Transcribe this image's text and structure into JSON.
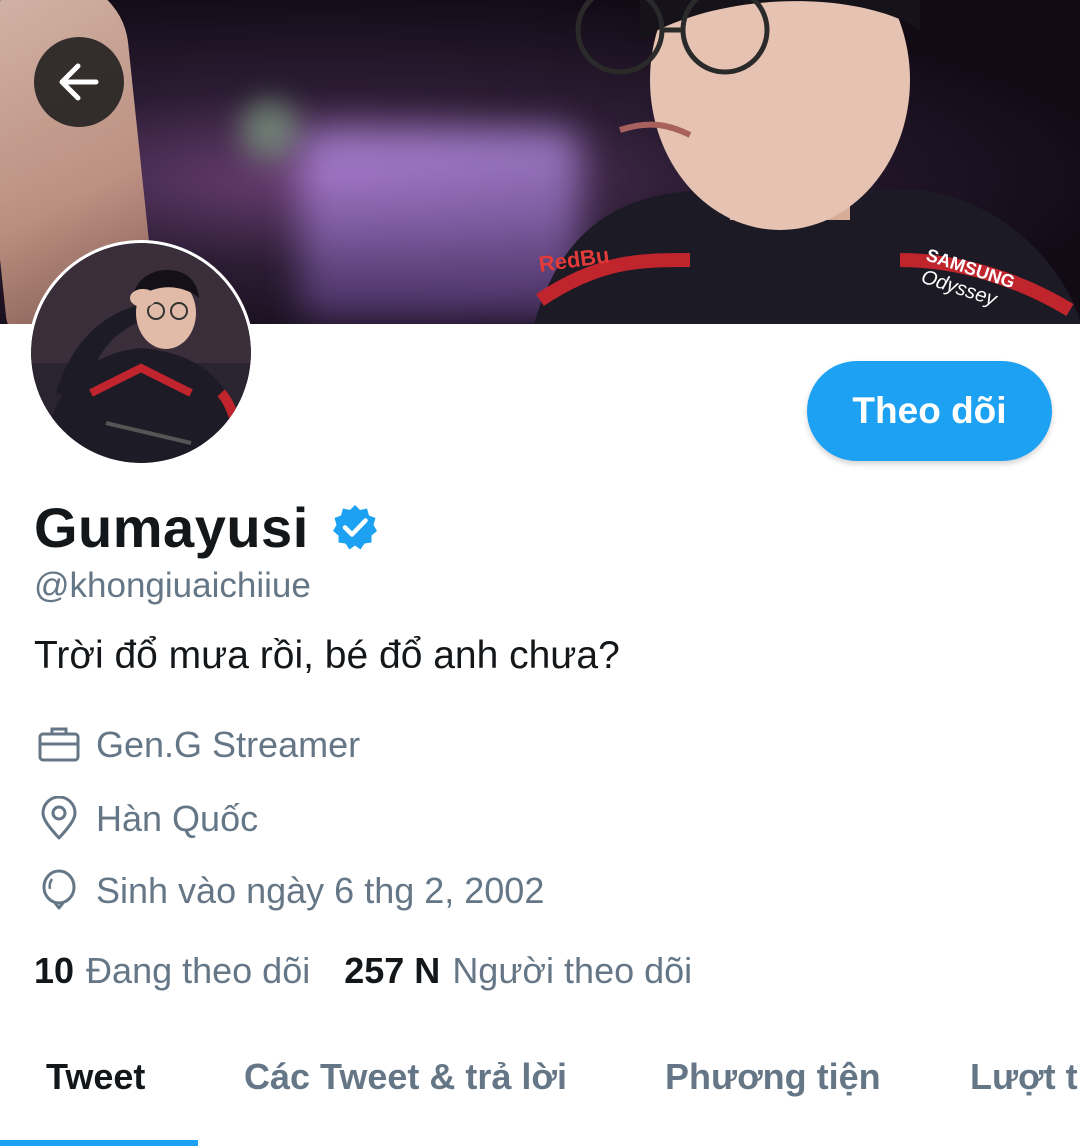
{
  "header": {
    "back_icon": "arrow-left-icon"
  },
  "profile": {
    "display_name": "Gumayusi",
    "verified_icon": "verified-badge-icon",
    "handle": "@khongiuaichiiue",
    "bio": "Trời đổ mưa rồi, bé đổ anh chưa?",
    "follow_button_label": "Theo dõi",
    "accent_color": "#1da1f2",
    "banner_text": {
      "sponsor1": "SAMSUNG",
      "sponsor2": "Odyssey",
      "sponsor3": "RedBu"
    },
    "meta": {
      "work": {
        "icon": "briefcase-icon",
        "text": "Gen.G Streamer"
      },
      "location": {
        "icon": "location-pin-icon",
        "text": "Hàn Quốc"
      },
      "birthday": {
        "icon": "balloon-icon",
        "text": "Sinh vào ngày 6 thg 2, 2002"
      }
    },
    "stats": {
      "following_count": "10",
      "following_label": "Đang theo dõi",
      "followers_count": "257 N",
      "followers_label": "Người theo dõi"
    }
  },
  "tabs": [
    {
      "label": "Tweet",
      "active": true
    },
    {
      "label": "Các Tweet & trả lời",
      "active": false
    },
    {
      "label": "Phương tiện",
      "active": false
    },
    {
      "label": "Lượt thích",
      "active": false
    }
  ]
}
